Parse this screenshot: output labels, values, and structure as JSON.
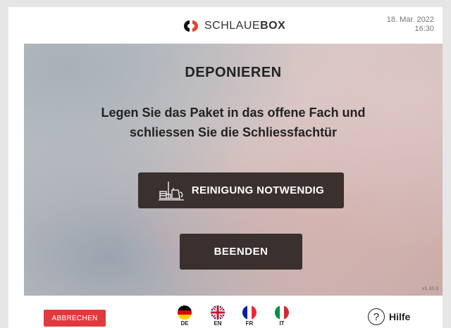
{
  "header": {
    "brand_prefix": "SCHLAUE",
    "brand_suffix": "BOX",
    "date": "18. Mar. 2022",
    "time": "16:30"
  },
  "main": {
    "title": "DEPONIEREN",
    "instruction": "Legen Sie das Paket in das offene Fach und schliessen Sie die Schliessfachtür",
    "clean_button": "REINIGUNG NOTWENDIG",
    "end_button": "BEENDEN",
    "version": "v1.10.3"
  },
  "footer": {
    "cancel_button": "ABBRECHEN",
    "languages": [
      {
        "code": "DE",
        "flag": "germany-flag"
      },
      {
        "code": "EN",
        "flag": "uk-flag"
      },
      {
        "code": "FR",
        "flag": "france-flag"
      },
      {
        "code": "IT",
        "flag": "italy-flag"
      }
    ],
    "help_label": "Hilfe"
  },
  "colors": {
    "accent_red": "#e03a3e",
    "button_dark": "#3a302e",
    "logo_red": "#e8452c"
  }
}
